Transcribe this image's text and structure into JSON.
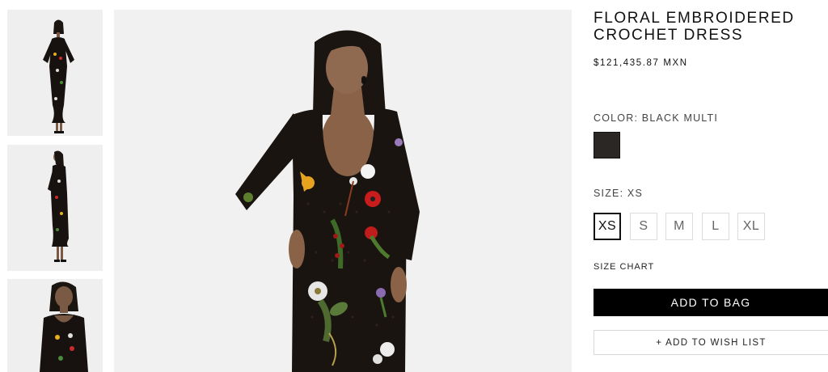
{
  "gallery": {
    "thumbnails": [
      {
        "view": "front full-length",
        "selected": true
      },
      {
        "view": "side full-length",
        "selected": false
      },
      {
        "view": "front close-up",
        "selected": false
      }
    ],
    "main_view": "front"
  },
  "product": {
    "title": "FLORAL EMBROIDERED CROCHET DRESS",
    "price": "$121,435.87 MXN",
    "color_label": "COLOR: BLACK MULTI",
    "swatch_color": "#2b2724",
    "size_label": "SIZE: XS",
    "sizes": [
      "XS",
      "S",
      "M",
      "L",
      "XL"
    ],
    "selected_size": "XS",
    "size_chart_label": "SIZE CHART",
    "add_to_bag_label": "ADD TO BAG",
    "add_to_wishlist_label": "+ ADD TO WISH LIST"
  },
  "colors": {
    "accent": "#000000",
    "background": "#ffffff",
    "image_backdrop": "#f1f1f1"
  }
}
